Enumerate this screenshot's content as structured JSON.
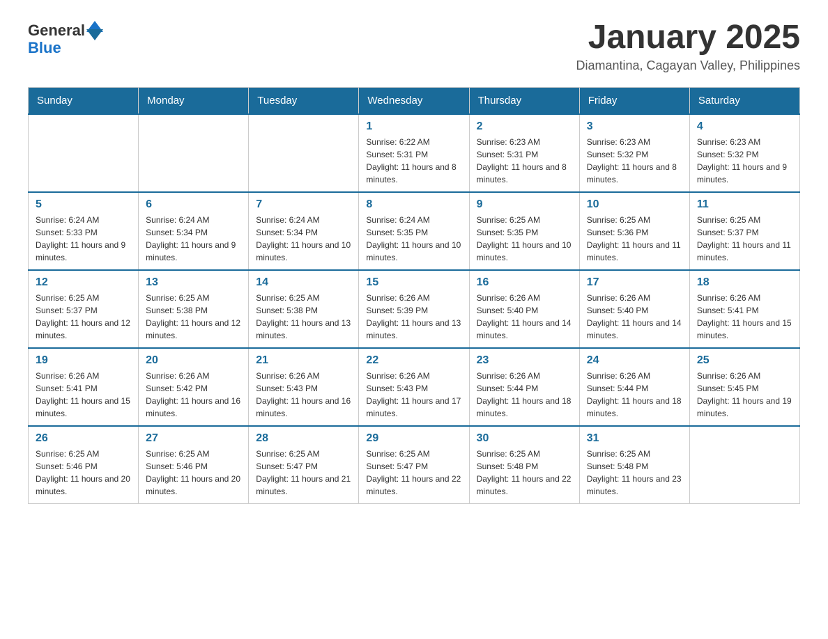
{
  "header": {
    "logo_general": "General",
    "logo_blue": "Blue",
    "month_title": "January 2025",
    "location": "Diamantina, Cagayan Valley, Philippines"
  },
  "weekdays": [
    "Sunday",
    "Monday",
    "Tuesday",
    "Wednesday",
    "Thursday",
    "Friday",
    "Saturday"
  ],
  "weeks": [
    [
      {
        "day": "",
        "info": ""
      },
      {
        "day": "",
        "info": ""
      },
      {
        "day": "",
        "info": ""
      },
      {
        "day": "1",
        "info": "Sunrise: 6:22 AM\nSunset: 5:31 PM\nDaylight: 11 hours and 8 minutes."
      },
      {
        "day": "2",
        "info": "Sunrise: 6:23 AM\nSunset: 5:31 PM\nDaylight: 11 hours and 8 minutes."
      },
      {
        "day": "3",
        "info": "Sunrise: 6:23 AM\nSunset: 5:32 PM\nDaylight: 11 hours and 8 minutes."
      },
      {
        "day": "4",
        "info": "Sunrise: 6:23 AM\nSunset: 5:32 PM\nDaylight: 11 hours and 9 minutes."
      }
    ],
    [
      {
        "day": "5",
        "info": "Sunrise: 6:24 AM\nSunset: 5:33 PM\nDaylight: 11 hours and 9 minutes."
      },
      {
        "day": "6",
        "info": "Sunrise: 6:24 AM\nSunset: 5:34 PM\nDaylight: 11 hours and 9 minutes."
      },
      {
        "day": "7",
        "info": "Sunrise: 6:24 AM\nSunset: 5:34 PM\nDaylight: 11 hours and 10 minutes."
      },
      {
        "day": "8",
        "info": "Sunrise: 6:24 AM\nSunset: 5:35 PM\nDaylight: 11 hours and 10 minutes."
      },
      {
        "day": "9",
        "info": "Sunrise: 6:25 AM\nSunset: 5:35 PM\nDaylight: 11 hours and 10 minutes."
      },
      {
        "day": "10",
        "info": "Sunrise: 6:25 AM\nSunset: 5:36 PM\nDaylight: 11 hours and 11 minutes."
      },
      {
        "day": "11",
        "info": "Sunrise: 6:25 AM\nSunset: 5:37 PM\nDaylight: 11 hours and 11 minutes."
      }
    ],
    [
      {
        "day": "12",
        "info": "Sunrise: 6:25 AM\nSunset: 5:37 PM\nDaylight: 11 hours and 12 minutes."
      },
      {
        "day": "13",
        "info": "Sunrise: 6:25 AM\nSunset: 5:38 PM\nDaylight: 11 hours and 12 minutes."
      },
      {
        "day": "14",
        "info": "Sunrise: 6:25 AM\nSunset: 5:38 PM\nDaylight: 11 hours and 13 minutes."
      },
      {
        "day": "15",
        "info": "Sunrise: 6:26 AM\nSunset: 5:39 PM\nDaylight: 11 hours and 13 minutes."
      },
      {
        "day": "16",
        "info": "Sunrise: 6:26 AM\nSunset: 5:40 PM\nDaylight: 11 hours and 14 minutes."
      },
      {
        "day": "17",
        "info": "Sunrise: 6:26 AM\nSunset: 5:40 PM\nDaylight: 11 hours and 14 minutes."
      },
      {
        "day": "18",
        "info": "Sunrise: 6:26 AM\nSunset: 5:41 PM\nDaylight: 11 hours and 15 minutes."
      }
    ],
    [
      {
        "day": "19",
        "info": "Sunrise: 6:26 AM\nSunset: 5:41 PM\nDaylight: 11 hours and 15 minutes."
      },
      {
        "day": "20",
        "info": "Sunrise: 6:26 AM\nSunset: 5:42 PM\nDaylight: 11 hours and 16 minutes."
      },
      {
        "day": "21",
        "info": "Sunrise: 6:26 AM\nSunset: 5:43 PM\nDaylight: 11 hours and 16 minutes."
      },
      {
        "day": "22",
        "info": "Sunrise: 6:26 AM\nSunset: 5:43 PM\nDaylight: 11 hours and 17 minutes."
      },
      {
        "day": "23",
        "info": "Sunrise: 6:26 AM\nSunset: 5:44 PM\nDaylight: 11 hours and 18 minutes."
      },
      {
        "day": "24",
        "info": "Sunrise: 6:26 AM\nSunset: 5:44 PM\nDaylight: 11 hours and 18 minutes."
      },
      {
        "day": "25",
        "info": "Sunrise: 6:26 AM\nSunset: 5:45 PM\nDaylight: 11 hours and 19 minutes."
      }
    ],
    [
      {
        "day": "26",
        "info": "Sunrise: 6:25 AM\nSunset: 5:46 PM\nDaylight: 11 hours and 20 minutes."
      },
      {
        "day": "27",
        "info": "Sunrise: 6:25 AM\nSunset: 5:46 PM\nDaylight: 11 hours and 20 minutes."
      },
      {
        "day": "28",
        "info": "Sunrise: 6:25 AM\nSunset: 5:47 PM\nDaylight: 11 hours and 21 minutes."
      },
      {
        "day": "29",
        "info": "Sunrise: 6:25 AM\nSunset: 5:47 PM\nDaylight: 11 hours and 22 minutes."
      },
      {
        "day": "30",
        "info": "Sunrise: 6:25 AM\nSunset: 5:48 PM\nDaylight: 11 hours and 22 minutes."
      },
      {
        "day": "31",
        "info": "Sunrise: 6:25 AM\nSunset: 5:48 PM\nDaylight: 11 hours and 23 minutes."
      },
      {
        "day": "",
        "info": ""
      }
    ]
  ]
}
